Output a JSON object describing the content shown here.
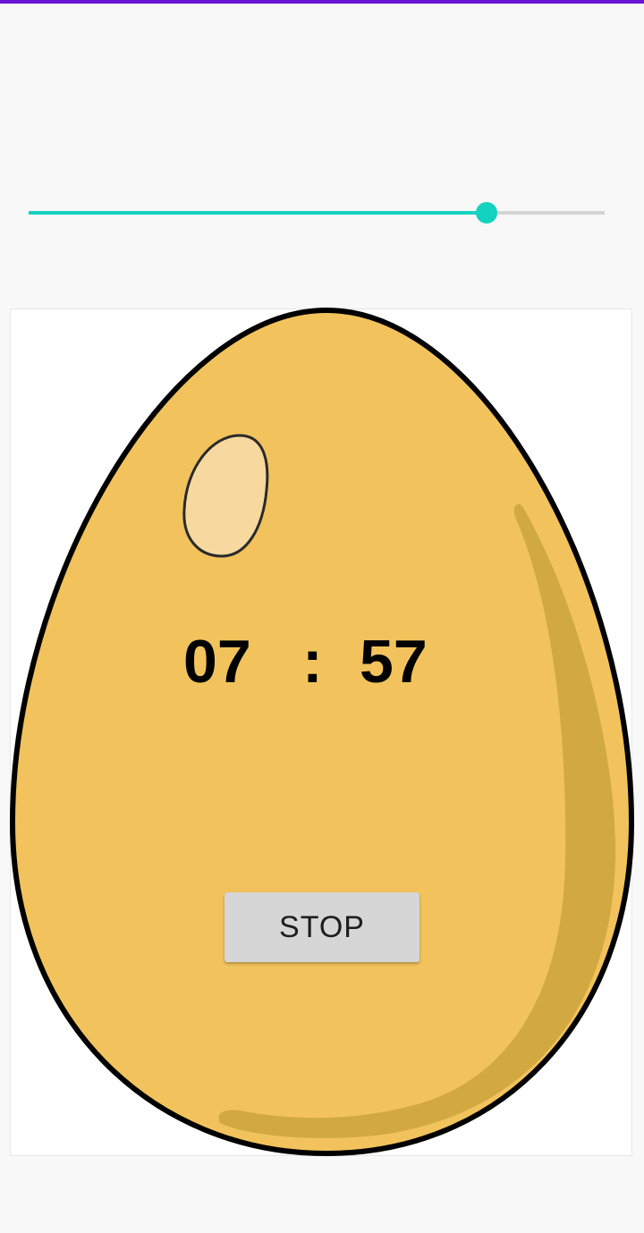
{
  "slider": {
    "value_fraction": 0.795
  },
  "timer": {
    "minutes": "07",
    "separator": ":",
    "seconds": "57"
  },
  "stop_button": {
    "label": "STOP"
  },
  "colors": {
    "accent_top_bar": "#6a14d8",
    "slider_active": "#14d2c0",
    "slider_inactive": "#d4d4d4",
    "egg_body": "#f2c35c",
    "egg_shade": "#d2a840",
    "egg_highlight": "#f7d9a0",
    "egg_outline": "#000000",
    "button_bg": "#d6d6d6"
  }
}
